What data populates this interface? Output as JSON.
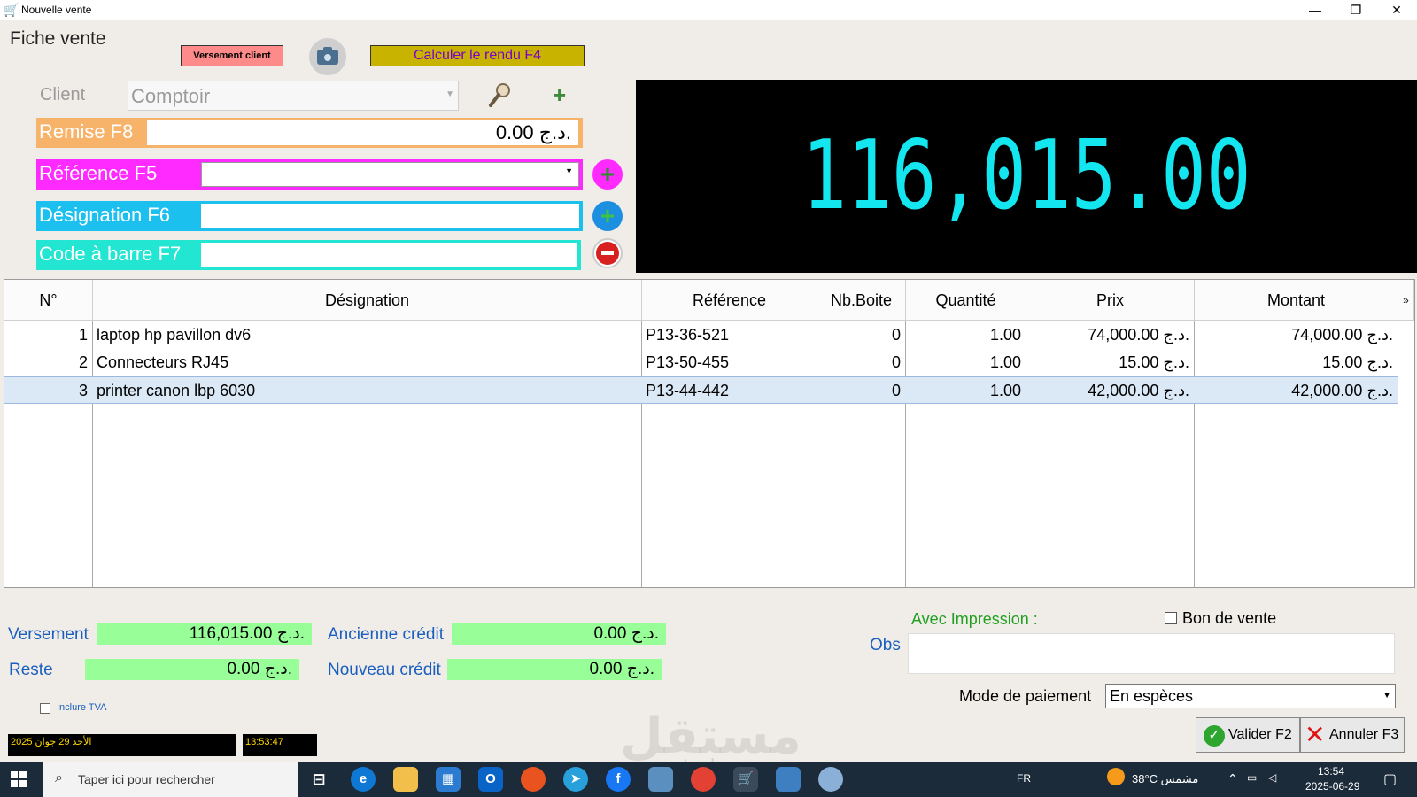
{
  "window": {
    "title": "Nouvelle vente",
    "minimize": "—",
    "restore": "❐",
    "close": "✕"
  },
  "form": {
    "title": "Fiche vente",
    "versement_button": "Versement client",
    "calc_button": "Calculer le rendu F4",
    "client_label": "Client",
    "client_value": "Comptoir",
    "remise_label": "Remise F8",
    "remise_value": "0.00 د.ج.",
    "reference_label": "Référence F5",
    "designation_label": "Désignation F6",
    "barcode_label": "Code à barre F7"
  },
  "total_display": "116,015.00 د.ج.",
  "grid": {
    "headers": [
      "N°",
      "Désignation",
      "Référence",
      "Nb.Boite",
      "Quantité",
      "Prix",
      "Montant"
    ],
    "rows": [
      {
        "n": "1",
        "designation": "laptop hp pavillon dv6",
        "reference": "P13-36-521",
        "nb_boite": "0",
        "quantite": "1.00",
        "prix": "74,000.00 د.ج.",
        "montant": "74,000.00 د.ج."
      },
      {
        "n": "2",
        "designation": "Connecteurs RJ45",
        "reference": "P13-50-455",
        "nb_boite": "0",
        "quantite": "1.00",
        "prix": "15.00 د.ج.",
        "montant": "15.00 د.ج."
      },
      {
        "n": "3",
        "designation": "printer canon lbp 6030",
        "reference": "P13-44-442",
        "nb_boite": "0",
        "quantite": "1.00",
        "prix": "42,000.00 د.ج.",
        "montant": "42,000.00 د.ج."
      }
    ]
  },
  "footer": {
    "versement_label": "Versement",
    "versement_value": "116,015.00 د.ج.",
    "reste_label": "Reste",
    "reste_value": "0.00 د.ج.",
    "ancienne_credit_label": "Ancienne crédit",
    "ancienne_credit_value": "0.00 د.ج.",
    "nouveau_credit_label": "Nouveau crédit",
    "nouveau_credit_value": "0.00 د.ج.",
    "impression_label": "Avec Impression :",
    "bon_vente_label": "Bon de vente",
    "obs_label": "Obs",
    "mode_label": "Mode de paiement",
    "mode_value": "En espèces",
    "tva_label": "Inclure TVA",
    "valider_label": "Valider F2",
    "annuler_label": "Annuler F3",
    "date_text": "الأحد 29 جوان 2025",
    "time_text": "13:53:47"
  },
  "watermark": {
    "main": "مستقل",
    "sub": "mostaql.com"
  },
  "taskbar": {
    "search_placeholder": "Taper ici pour rechercher",
    "lang": "FR",
    "weather": "38°C  مشمس",
    "clock_time": "13:54",
    "clock_date": "2025-06-29"
  }
}
